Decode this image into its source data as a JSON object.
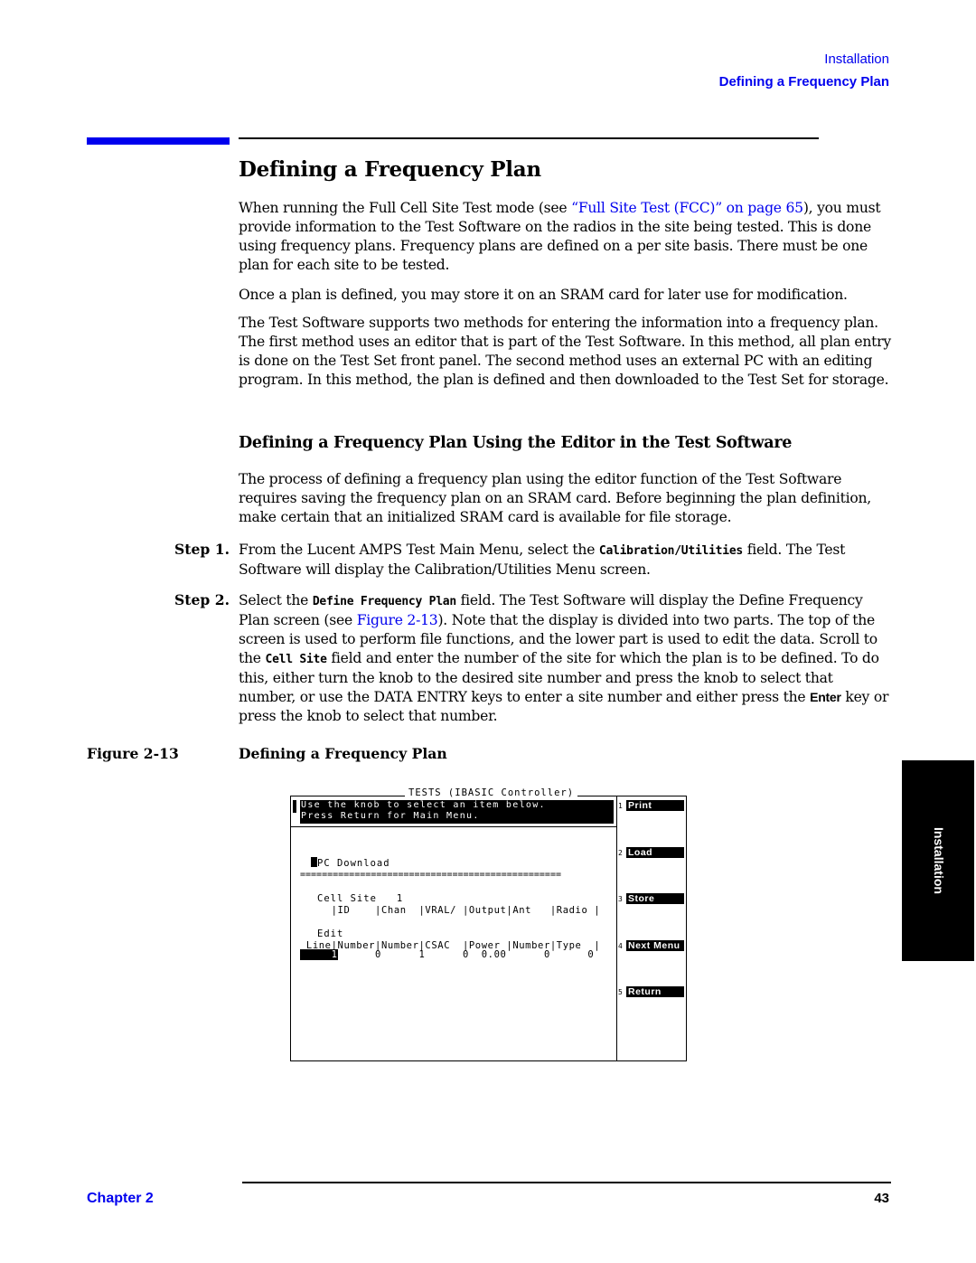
{
  "header": {
    "section": "Installation",
    "title": "Defining a Frequency Plan"
  },
  "main": {
    "title": "Defining a Frequency Plan",
    "p1_a": "When running the Full Cell Site Test mode (see ",
    "p1_link": "“Full Site Test (FCC)” on page 65",
    "p1_b": "), you must provide information to the Test Software on the radios in the site being tested. This is done using frequency plans. Frequency plans are defined on a per site basis. There must be one plan for each site to be tested.",
    "p2": "Once a plan is defined, you may store it on an SRAM card for later use for modification.",
    "p3": "The Test Software supports two methods for entering the information into a frequency plan. The first method uses an editor that is part of the Test Software. In this method, all plan entry is done on the Test Set front panel. The second method uses an external PC with an editing program. In this method, the plan is defined and then downloaded to the Test Set for storage.",
    "subtitle": "Defining a Frequency Plan Using the Editor in the Test Software",
    "p4": "The process of defining a frequency plan using the editor function of the Test Software requires saving the frequency plan on an SRAM card. Before beginning the plan definition, make certain that an initialized SRAM card is available for file storage.",
    "step1": {
      "label": "Step 1.",
      "a": "From the Lucent AMPS Test Main Menu, select the ",
      "code": "Calibration/Utilities",
      "b": " field. The Test Software will display the Calibration/Utilities Menu screen."
    },
    "step2": {
      "label": "Step 2.",
      "a": "Select the ",
      "code1": "Define Frequency Plan",
      "b": " field. The Test Software will display the Define Frequency Plan screen (see ",
      "link": "Figure 2-13",
      "c": "). Note that the display is divided into two parts. The top of the screen is used to perform file functions, and the lower part is used to edit the data. Scroll to the ",
      "code2": "Cell Site",
      "d": " field and enter the number of the site for which the plan is to be defined. To do this, either turn the knob to the desired site number and press the knob to select that number, or use the DATA ENTRY keys to enter a site number and either press the ",
      "key": "Enter",
      "e": " key or press the knob to select that number."
    },
    "figure": {
      "label": "Figure 2-13",
      "title": "Defining a Frequency Plan"
    }
  },
  "screen": {
    "title": "TESTS (IBASIC Controller)",
    "message_line1": "Use the knob to select an item below.",
    "message_line2": "Press Return for Main Menu.",
    "menu": [
      "PC Download",
      "Cell Site   1",
      "Edit"
    ],
    "separator": "================================================",
    "header_row1": "     |ID    |Chan  |VRAL/ |Output|Ant   |Radio |",
    "header_row2": " Line|Number|Number|CSAC  |Power |Number|Type  |",
    "data_row_line": "     1",
    "data_row_rest": "      0      1      0  0.00      0      0",
    "softkeys": [
      {
        "num": "1",
        "label": "Print"
      },
      {
        "num": "2",
        "label": "Load"
      },
      {
        "num": "3",
        "label": "Store"
      },
      {
        "num": "4",
        "label": "Next Menu"
      },
      {
        "num": "5",
        "label": "Return"
      }
    ]
  },
  "side_tab": "Installation",
  "footer": {
    "chapter": "Chapter 2",
    "page": "43"
  }
}
